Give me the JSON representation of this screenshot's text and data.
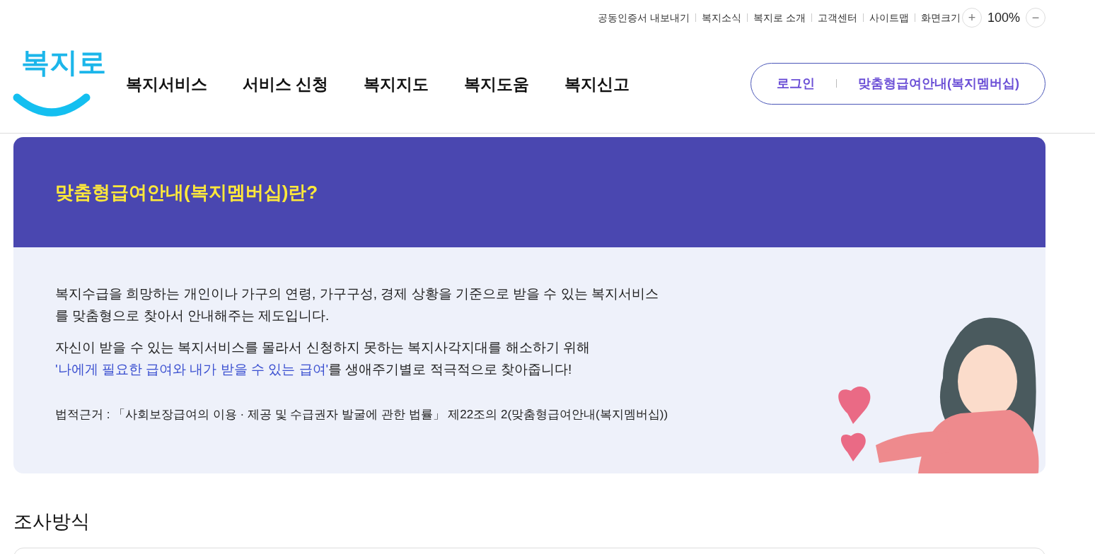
{
  "utility_links": [
    "공동인증서 내보내기",
    "복지소식",
    "복지로 소개",
    "고객센터",
    "사이트맵"
  ],
  "zoom": {
    "label": "화면크기",
    "plus": "+",
    "value": "100%",
    "minus": "−"
  },
  "logo": "복지로",
  "nav": [
    "복지서비스",
    "서비스 신청",
    "복지지도",
    "복지도움",
    "복지신고"
  ],
  "account_links": [
    "로그인",
    "맞춤형급여안내(복지멤버십)"
  ],
  "banner": {
    "title": "맞춤형급여안내(복지멤버십)란?",
    "paragraphs": [
      {
        "text": "복지수급을 희망하는 개인이나 가구의 연령, 가구구성, 경제 상황을 기준으로 받을 수 있는 복지서비스를 맞춤형으로 찾아서 안내해주는 제도입니다."
      },
      {
        "text": "자신이 받을 수 있는 복지서비스를 몰라서 신청하지 못하는 복지사각지대를 해소하기 위해",
        "highlight": "'나에게 필요한 급여와 내가 받을 수 있는 급여'",
        "tail": "를 생애주기별로 적극적으로 찾아줍니다!"
      }
    ],
    "legal_basis": "법적근거 : 「사회보장급여의 이용 · 제공 및 수급권자 발굴에 관한 법률」 제22조의 2(맞춤형급여안내(복지멤버십))"
  },
  "section_title": "조사방식"
}
